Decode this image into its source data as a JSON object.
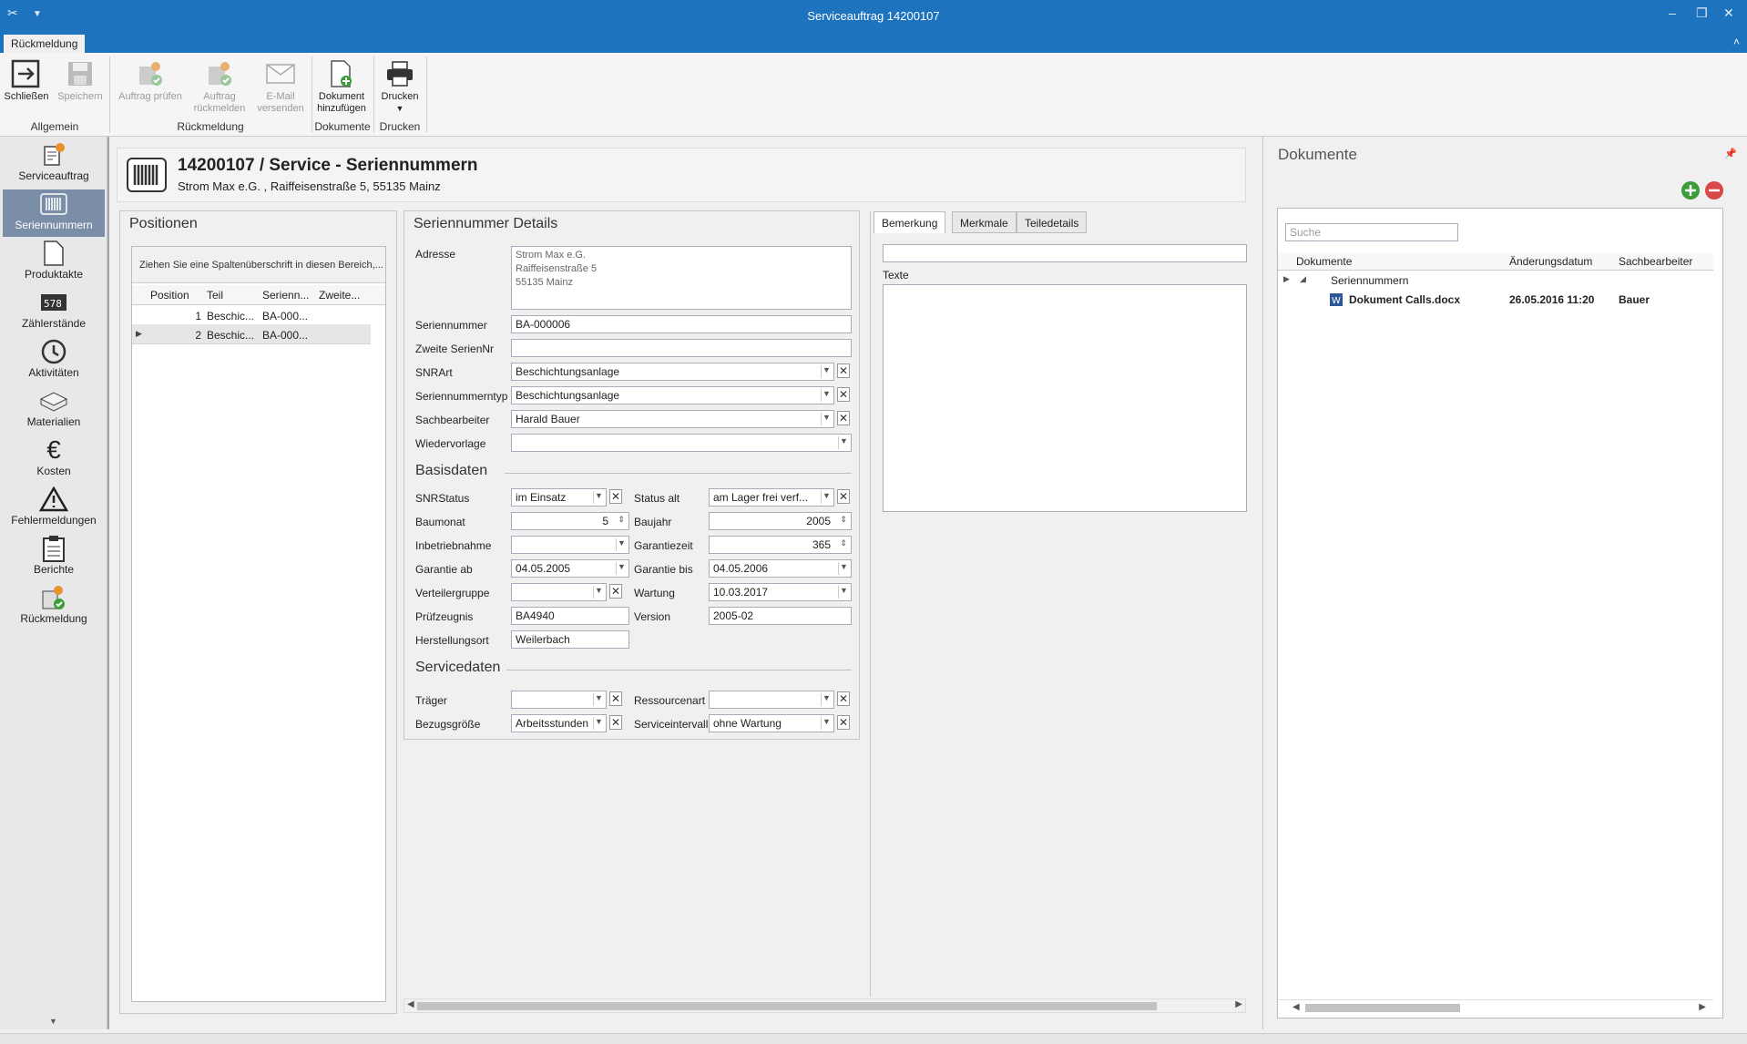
{
  "window": {
    "title": "Serviceauftrag 14200107"
  },
  "ribbon": {
    "tab": "Rückmeldung",
    "buttons": {
      "close": "Schließen",
      "save": "Speichern",
      "check": [
        "Auftrag prüfen"
      ],
      "report": [
        "Auftrag",
        "rückmelden"
      ],
      "email": [
        "E-Mail",
        "versenden"
      ],
      "add_doc": [
        "Dokument",
        "hinzufügen"
      ],
      "print": "Drucken"
    },
    "groups": {
      "general": "Allgemein",
      "feedback": "Rückmeldung",
      "documents": "Dokumente",
      "print": "Drucken"
    }
  },
  "nav": [
    {
      "label": "Serviceauftrag",
      "icon": "service-order-icon"
    },
    {
      "label": "Seriennummern",
      "icon": "barcode-icon",
      "active": true
    },
    {
      "label": "Produktakte",
      "icon": "document-icon"
    },
    {
      "label": "Zählerstände",
      "icon": "counter-icon"
    },
    {
      "label": "Aktivitäten",
      "icon": "history-icon"
    },
    {
      "label": "Materialien",
      "icon": "box-icon"
    },
    {
      "label": "Kosten",
      "icon": "euro-icon"
    },
    {
      "label": "Fehlermeldungen",
      "icon": "warning-icon"
    },
    {
      "label": "Berichte",
      "icon": "clipboard-icon"
    },
    {
      "label": "Rückmeldung",
      "icon": "feedback-icon"
    }
  ],
  "header": {
    "title": "14200107 / Service - Seriennummern",
    "subtitle": "Strom Max e.G. , Raiffeisenstraße 5, 55135 Mainz"
  },
  "positions": {
    "title": "Positionen",
    "group_hint": "Ziehen Sie eine Spaltenüberschrift in diesen Bereich,...",
    "columns": [
      "Position",
      "Teil",
      "Serienn...",
      "Zweite..."
    ],
    "rows": [
      [
        "1",
        "Beschic...",
        "BA-000...",
        ""
      ],
      [
        "2",
        "Beschic...",
        "BA-000...",
        ""
      ]
    ]
  },
  "details": {
    "title": "Seriennummer Details",
    "address_label": "Adresse",
    "address": [
      "Strom Max e.G.",
      "Raiffeisenstraße 5",
      "55135 Mainz"
    ],
    "fields": [
      {
        "label": "Seriennummer",
        "value": "BA-000006"
      },
      {
        "label": "Zweite SerienNr",
        "value": ""
      },
      {
        "label": "SNRArt",
        "value": "Beschichtungsanlage"
      },
      {
        "label": "Seriennummerntyp",
        "value": "Beschichtungsanlage"
      },
      {
        "label": "Sachbearbeiter",
        "value": "Harald Bauer"
      },
      {
        "label": "Wiedervorlage",
        "value": ""
      }
    ],
    "basis_title": "Basisdaten",
    "basis_left": [
      {
        "label": "SNRStatus",
        "value": "im Einsatz"
      },
      {
        "label": "Baumonat",
        "value": "5"
      },
      {
        "label": "Inbetriebnahme",
        "value": ""
      },
      {
        "label": "Garantie ab",
        "value": "04.05.2005"
      },
      {
        "label": "Verteilergruppe",
        "value": ""
      },
      {
        "label": "Prüfzeugnis",
        "value": "BA4940"
      },
      {
        "label": "Herstellungsort",
        "value": "Weilerbach"
      }
    ],
    "basis_right": [
      {
        "label": "Status alt",
        "value": "am Lager frei verf..."
      },
      {
        "label": "Baujahr",
        "value": "2005"
      },
      {
        "label": "Garantiezeit",
        "value": "365"
      },
      {
        "label": "Garantie bis",
        "value": "04.05.2006"
      },
      {
        "label": "Wartung",
        "value": "10.03.2017"
      },
      {
        "label": "Version",
        "value": "2005-02"
      }
    ],
    "service_title": "Servicedaten",
    "service_left": [
      {
        "label": "Träger",
        "value": ""
      },
      {
        "label": "Bezugsgröße",
        "value": "Arbeitsstunden"
      }
    ],
    "service_right": [
      {
        "label": "Ressourcenart",
        "value": ""
      },
      {
        "label": "Serviceintervall",
        "value": "ohne Wartung"
      }
    ]
  },
  "notes": {
    "tabs": [
      "Bemerkung",
      "Merkmale",
      "Teiledetails"
    ],
    "texte_label": "Texte"
  },
  "docs": {
    "title": "Dokumente",
    "search_placeholder": "Suche",
    "columns": [
      "Dokumente",
      "Änderungsdatum",
      "Sachbearbeiter"
    ],
    "folder": "Seriennummern",
    "file": {
      "name": "Dokument Calls.docx",
      "date": "26.05.2016 11:20",
      "user": "Bauer"
    }
  }
}
